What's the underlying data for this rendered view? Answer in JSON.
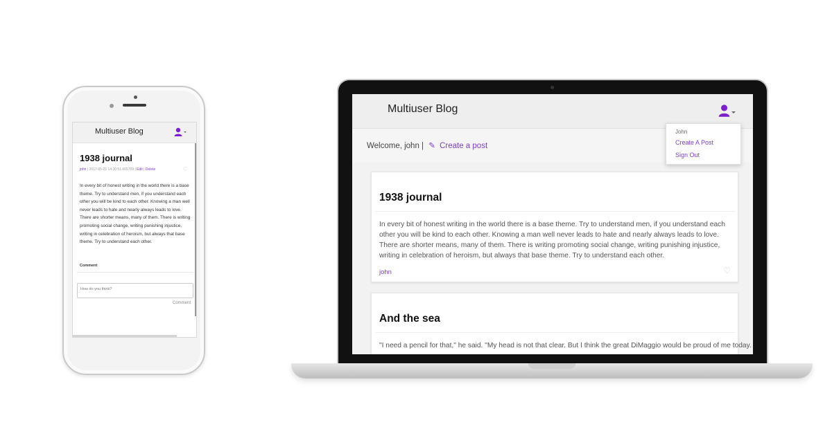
{
  "phone": {
    "brand": "Multiuser Blog",
    "post": {
      "title": "1938 journal",
      "author": "john",
      "timestamp": "2017-05-21 14:30:51.665769",
      "edit_label": "Edit",
      "delete_label": "Delete",
      "body": "In every bit of honest writing in the world there is a base theme. Try to understand men, if you understand each other you will be kind to each other. Knowing a man well never leads to hate and nearly always leads to love. There are shorter means, many of them. There is writing promoting social change, writing punishing injustice, writing in celebration of heroism, but always that base theme. Try to understand each other."
    },
    "comment": {
      "label": "Comment",
      "placeholder": "How do you think?",
      "button": "Comment"
    }
  },
  "laptop": {
    "brand": "Multiuser Blog",
    "welcome": "Welcome, john |",
    "create_link": "Create a post",
    "dropdown": {
      "user": "John",
      "items": [
        "Create A Post",
        "Sign Out"
      ]
    },
    "posts": [
      {
        "title": "1938 journal",
        "body": "In every bit of honest writing in the world there is a base theme. Try to understand men, if you understand each other you will be kind to each other. Knowing a man well never leads to hate and nearly always leads to love. There are shorter means, many of them. There is writing promoting social change, writing punishing injustice, writing in celebration of heroism, but always that base theme. Try to understand each other.",
        "author": "john"
      },
      {
        "title": "And the sea",
        "body": "\"I need a pencil for that,\" he said. \"My head is not that clear. But I think the great DiMaggio would be proud of me today. I had no"
      }
    ]
  },
  "colors": {
    "accent": "#7b3fc4",
    "nav_bg": "#eeeeee"
  },
  "icons": [
    "user-icon",
    "caret-down-icon",
    "heart-icon",
    "pencil-icon"
  ]
}
